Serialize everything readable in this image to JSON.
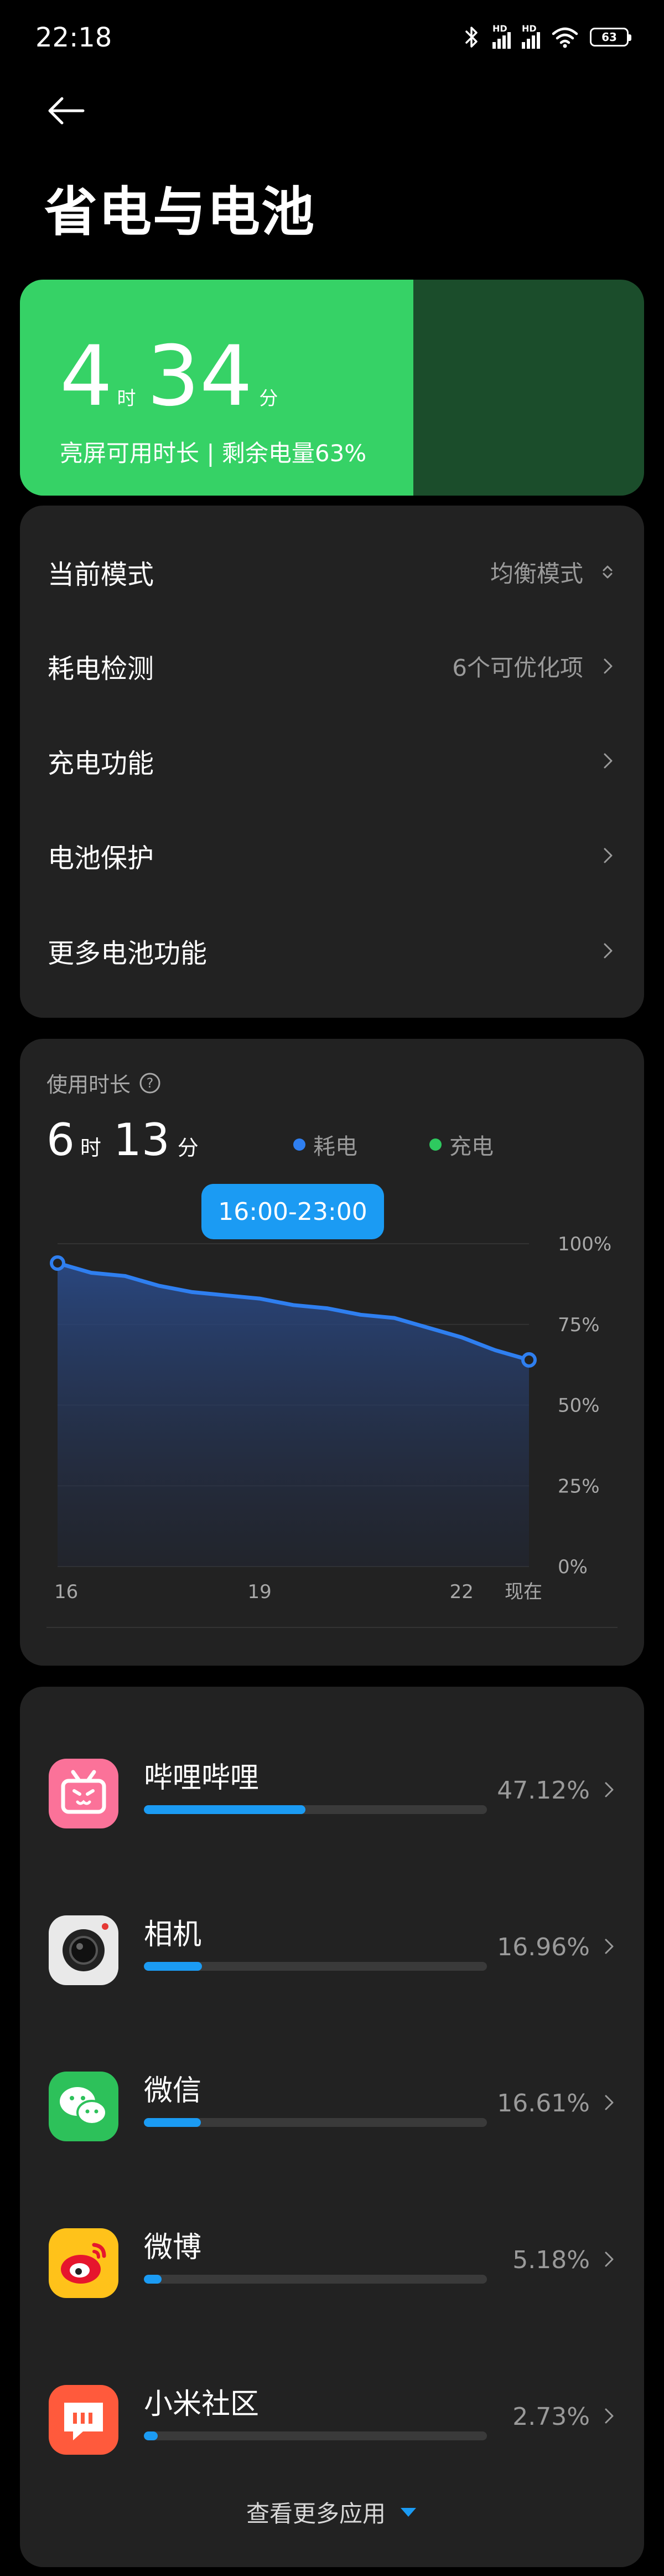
{
  "status_bar": {
    "time": "22:18",
    "hd1": "HD",
    "hd2": "HD",
    "battery": "63"
  },
  "page": {
    "title": "省电与电池"
  },
  "battery_summary": {
    "hours": "4",
    "hours_unit": "时",
    "minutes": "34",
    "minutes_unit": "分",
    "caption": "亮屏可用时长 | 剩余电量63%",
    "level_percent": 63,
    "fill_color": "#36d266",
    "empty_color": "#1b4d2b"
  },
  "menu": {
    "mode": {
      "label": "当前模式",
      "value": "均衡模式"
    },
    "detect": {
      "label": "耗电检测",
      "value": "6个可优化项"
    },
    "charging": {
      "label": "充电功能"
    },
    "protect": {
      "label": "电池保护"
    },
    "more": {
      "label": "更多电池功能"
    }
  },
  "usage": {
    "title": "使用时长",
    "hours": "6",
    "hours_unit": "时",
    "minutes": "13",
    "minutes_unit": "分",
    "legend": {
      "consume": "耗电",
      "charge": "充电"
    },
    "consume_color": "#2f7ff0",
    "charge_color": "#2ec95f",
    "range_pill": "16:00-23:00"
  },
  "chart_data": {
    "type": "area",
    "x": [
      16,
      16.5,
      17,
      17.5,
      18,
      18.5,
      19,
      19.5,
      20,
      20.5,
      21,
      21.5,
      22,
      22.5,
      23
    ],
    "values": [
      94,
      91,
      90,
      87,
      85,
      84,
      83,
      81,
      80,
      78,
      77,
      74,
      71,
      67,
      64
    ],
    "series": [
      {
        "name": "耗电",
        "values": [
          94,
          91,
          90,
          87,
          85,
          84,
          83,
          81,
          80,
          78,
          77,
          74,
          71,
          67,
          64
        ]
      }
    ],
    "x_tick_labels": [
      "16",
      "19",
      "22",
      "现在"
    ],
    "y_tick_labels": [
      "100%",
      "75%",
      "50%",
      "25%",
      "0%"
    ],
    "ylim": [
      0,
      100
    ],
    "xlim": [
      16,
      23
    ],
    "grid": true
  },
  "apps": [
    {
      "name": "哔哩哔哩",
      "percent": "47.12%",
      "share": 47.12,
      "icon": "bilibili-icon",
      "color": "#fb7299"
    },
    {
      "name": "相机",
      "percent": "16.96%",
      "share": 16.96,
      "icon": "camera-icon",
      "color": "#e9e9e9"
    },
    {
      "name": "微信",
      "percent": "16.61%",
      "share": 16.61,
      "icon": "wechat-icon",
      "color": "#2dc15a"
    },
    {
      "name": "微博",
      "percent": "5.18%",
      "share": 5.18,
      "icon": "weibo-icon",
      "color": "#ffc21a"
    },
    {
      "name": "小米社区",
      "percent": "2.73%",
      "share": 2.73,
      "icon": "mi-community-icon",
      "color": "#ff5a3c"
    }
  ],
  "more_apps": {
    "label": "查看更多应用"
  }
}
